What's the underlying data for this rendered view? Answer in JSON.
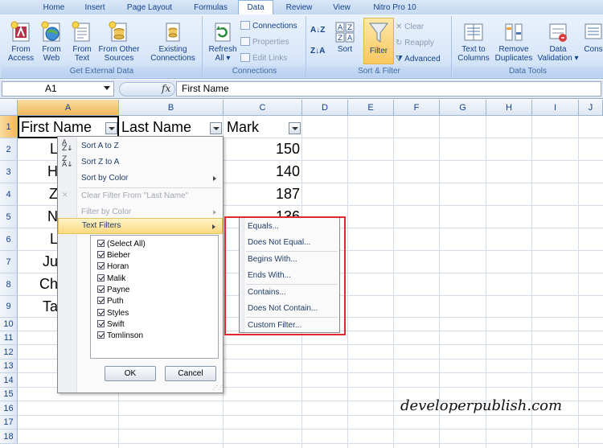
{
  "tabs": [
    {
      "label": "Home"
    },
    {
      "label": "Insert"
    },
    {
      "label": "Page Layout"
    },
    {
      "label": "Formulas"
    },
    {
      "label": "Data"
    },
    {
      "label": "Review"
    },
    {
      "label": "View"
    },
    {
      "label": "Nitro Pro 10"
    }
  ],
  "ribbon": {
    "get_external": {
      "title": "Get External Data",
      "from_access": "From Access",
      "from_web": "From Web",
      "from_text": "From Text",
      "from_other": "From Other Sources",
      "existing": "Existing Connections"
    },
    "connections": {
      "title": "Connections",
      "refresh": "Refresh All",
      "connections": "Connections",
      "properties": "Properties",
      "edit_links": "Edit Links"
    },
    "sort_filter": {
      "title": "Sort & Filter",
      "sort": "Sort",
      "filter": "Filter",
      "clear": "Clear",
      "reapply": "Reapply",
      "advanced": "Advanced"
    },
    "data_tools": {
      "title": "Data Tools",
      "text_to_columns": "Text to Columns",
      "remove_duplicates": "Remove Duplicates",
      "data_validation": "Data Validation",
      "consolidate": "Cons"
    }
  },
  "formula_bar": {
    "name_box": "A1",
    "fx": "fx",
    "content": "First Name"
  },
  "columns": [
    "A",
    "B",
    "C",
    "D",
    "E",
    "F",
    "G",
    "H",
    "I",
    "J"
  ],
  "rows": [
    "1",
    "2",
    "3",
    "4",
    "5",
    "6",
    "7",
    "8",
    "9",
    "10",
    "11",
    "12",
    "13",
    "14",
    "15",
    "16",
    "17",
    "18"
  ],
  "sheet": {
    "headers": [
      "First Name",
      "Last Name",
      "Mark"
    ],
    "first_name_partial": [
      "L",
      "H",
      "Z",
      "N",
      "L",
      "Ju",
      "Ch",
      "Ta"
    ],
    "marks": [
      "150",
      "140",
      "187",
      "136"
    ]
  },
  "menu": {
    "sort_az": "Sort A to Z",
    "sort_za": "Sort Z to A",
    "sort_by_color": "Sort by Color",
    "clear_filter": "Clear Filter From \"Last Name\"",
    "filter_by_color": "Filter by Color",
    "text_filters": "Text Filters",
    "items": [
      "(Select All)",
      "Bieber",
      "Horan",
      "Malik",
      "Payne",
      "Puth",
      "Styles",
      "Swift",
      "Tomlinson"
    ],
    "ok": "OK",
    "cancel": "Cancel"
  },
  "submenu": [
    "Equals...",
    "Does Not Equal...",
    "Begins With...",
    "Ends With...",
    "Contains...",
    "Does Not Contain...",
    "Custom Filter..."
  ],
  "watermark": "developerpublish.com"
}
